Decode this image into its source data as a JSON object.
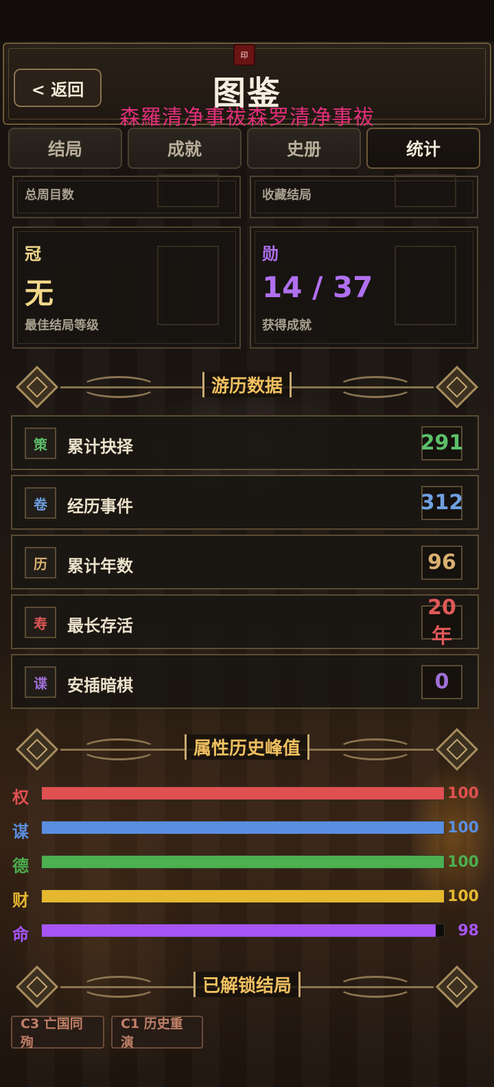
{
  "header": {
    "back_label": "< 返回",
    "title": "图鉴",
    "watermark": "森羅清净事祓森罗清净事祓",
    "seal": "印"
  },
  "tabs": [
    {
      "label": "结局",
      "active": false
    },
    {
      "label": "成就",
      "active": false
    },
    {
      "label": "史册",
      "active": false
    },
    {
      "label": "统计",
      "active": true
    }
  ],
  "stat_cards": {
    "total_cycles_label": "总周目数",
    "collected_endings_label": "收藏结局",
    "best_ending": {
      "char": "冠",
      "value": "无",
      "label": "最佳结局等级",
      "color": "#f2d88a"
    },
    "achievements": {
      "char": "勋",
      "value": "14 / 37",
      "label": "获得成就",
      "color": "#b070f0"
    }
  },
  "travel_section": {
    "title": "游历数据",
    "rows": [
      {
        "icon": "策",
        "label": "累计抉择",
        "value": "291",
        "color": "#5cbf6a"
      },
      {
        "icon": "卷",
        "label": "经历事件",
        "value": "312",
        "color": "#6fa0e0"
      },
      {
        "icon": "历",
        "label": "累计年数",
        "value": "96",
        "color": "#d8b070"
      },
      {
        "icon": "寿",
        "label": "最长存活",
        "value_num": "20",
        "value_unit": "年",
        "color": "#e05858"
      },
      {
        "icon": "谍",
        "label": "安插暗棋",
        "value": "0",
        "color": "#a070d8"
      }
    ]
  },
  "attribute_section": {
    "title": "属性历史峰值",
    "attributes": [
      {
        "char": "权",
        "value": "100",
        "fraction": 1.0,
        "color": "#e05050"
      },
      {
        "char": "谋",
        "value": "100",
        "fraction": 1.0,
        "color": "#5a8ee0"
      },
      {
        "char": "德",
        "value": "100",
        "fraction": 1.0,
        "color": "#4caf50"
      },
      {
        "char": "财",
        "value": "100",
        "fraction": 1.0,
        "color": "#e6b830"
      },
      {
        "char": "命",
        "value": "98",
        "fraction": 0.98,
        "color": "#a855f7"
      }
    ]
  },
  "endings_section": {
    "title": "已解锁结局",
    "endings": [
      "C3 亡国同殉",
      "C1 历史重演"
    ]
  }
}
